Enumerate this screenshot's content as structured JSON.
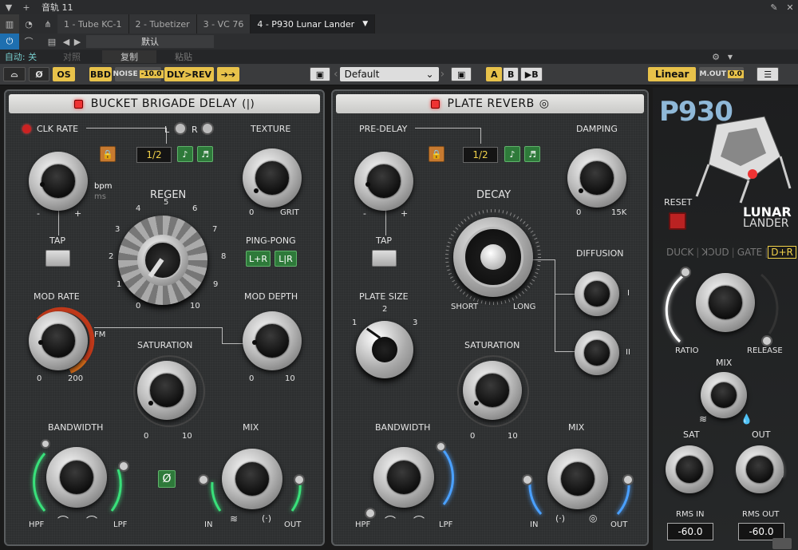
{
  "host": {
    "title": "音轨 11",
    "tabs": [
      "1 - Tube KC-1",
      "2 - Tubetizer",
      "3 - VC 76",
      "4 - P930 Lunar Lander"
    ],
    "preset_name": "默认",
    "auto_label": "自动: 关",
    "compare_label": "对照",
    "copy_label": "复制",
    "paste_label": "粘贴"
  },
  "toolbar": {
    "os": "OS",
    "bbd": "BBD",
    "noise_label": "NOISE",
    "noise_value": "-10.0",
    "routing": "DLY>REV",
    "preset": "Default",
    "a": "A",
    "b": "B",
    "copy_ab": "▶B",
    "mode": "Linear",
    "mout_label": "M.OUT",
    "mout_value": "0.0"
  },
  "delay": {
    "title": "BUCKET BRIGADE DELAY",
    "clk_rate": "CLK RATE",
    "lr_l": "L",
    "lr_r": "R",
    "sync_value": "1/2",
    "texture": "TEXTURE",
    "bpm": "bpm",
    "ms": "ms",
    "regen": "REGEN",
    "tap": "TAP",
    "ping_pong": "PING-PONG",
    "pp_a": "L+R",
    "pp_b": "L|R",
    "mod_rate": "MOD RATE",
    "fm": "FM",
    "mod_depth": "MOD DEPTH",
    "saturation": "SATURATION",
    "bandwidth": "BANDWIDTH",
    "mix": "MIX",
    "hpf": "HPF",
    "lpf": "LPF",
    "in": "IN",
    "out": "OUT",
    "minus": "-",
    "plus": "+",
    "zero": "0",
    "grit": "GRIT",
    "two_hundred": "200",
    "ten": "10",
    "regen_ticks": [
      "0",
      "1",
      "2",
      "3",
      "4",
      "5",
      "6",
      "7",
      "8",
      "9",
      "10"
    ]
  },
  "reverb": {
    "title": "PLATE REVERB",
    "pre_delay": "PRE-DELAY",
    "sync_value": "1/2",
    "damping": "DAMPING",
    "zero": "0",
    "fifteen_k": "15K",
    "decay": "DECAY",
    "short": "SHORT",
    "long": "LONG",
    "tap": "TAP",
    "diffusion": "DIFFUSION",
    "diff_1": "I",
    "diff_2": "II",
    "plate_size": "PLATE SIZE",
    "ps_1": "1",
    "ps_2": "2",
    "ps_3": "3",
    "saturation": "SATURATION",
    "ten": "10",
    "bandwidth": "BANDWIDTH",
    "mix": "MIX",
    "hpf": "HPF",
    "lpf": "LPF",
    "in": "IN",
    "out": "OUT",
    "minus": "-",
    "plus": "+"
  },
  "side": {
    "logo": "P930",
    "lunar": "LUNAR",
    "lander": "LANDER",
    "reset": "RESET",
    "modes": [
      "DUCK",
      "ꓘƆUD",
      "GATE",
      "D+R"
    ],
    "ratio": "RATIO",
    "release": "RELEASE",
    "mix": "MIX",
    "sat": "SAT",
    "out": "OUT",
    "rms_in": "RMS IN",
    "rms_out": "RMS OUT",
    "rms_in_value": "-60.0",
    "rms_out_value": "-60.0"
  },
  "colors": {
    "accent": "#e8c24a",
    "led": "#e33333",
    "green_arc": "#39e07a",
    "blue_arc": "#4aa0ff",
    "orange_arc": "#d06a1a"
  }
}
